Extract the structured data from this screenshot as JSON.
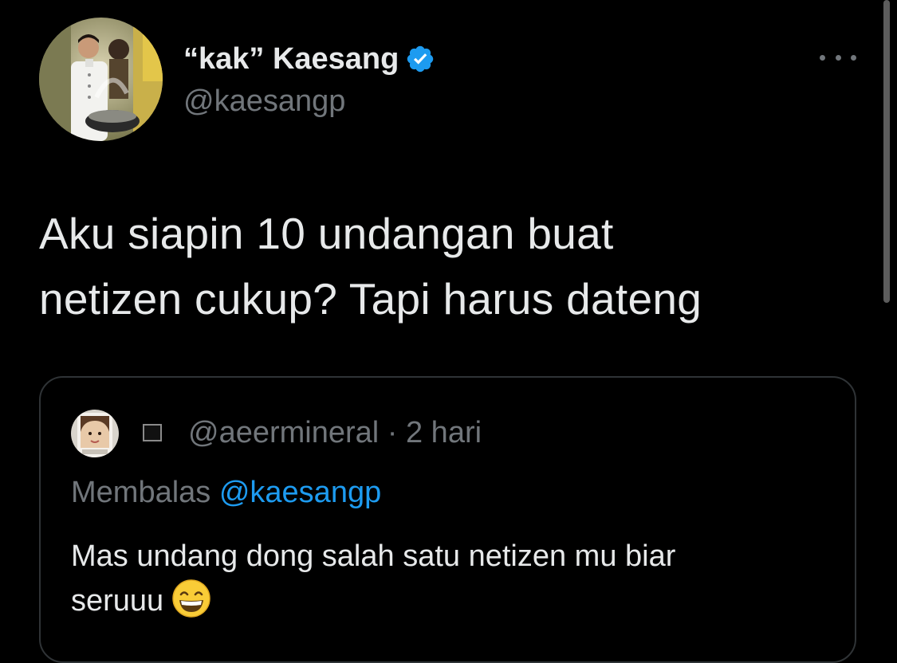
{
  "author": {
    "display_name": "“kak” Kaesang",
    "handle": "@kaesangp",
    "avatar": "chef-cooking-wok-photo",
    "verified_icon": "verified-badge-icon"
  },
  "menu": {
    "more_icon": "more-horizontal-icon"
  },
  "tweet": {
    "lines": [
      "Aku siapin 10 undangan buat",
      "netizen cukup? Tapi harus dateng"
    ]
  },
  "quoted_tweet": {
    "avatar": "selfie-photo",
    "badge_icon": "black-square-icon",
    "meta": "@aeermineral · 2 hari",
    "reply_prefix": "Membalas ",
    "reply_mention": "@kaesangp",
    "lines": [
      "Mas undang dong salah satu netizen mu biar",
      "seruuu"
    ],
    "emoji": "grinning-face-with-smiling-eyes-emoji"
  },
  "colors": {
    "background": "#000000",
    "primary_text": "#e7e9ea",
    "secondary_text": "#71767b",
    "accent": "#1d9bf0",
    "border": "#2f3336"
  }
}
